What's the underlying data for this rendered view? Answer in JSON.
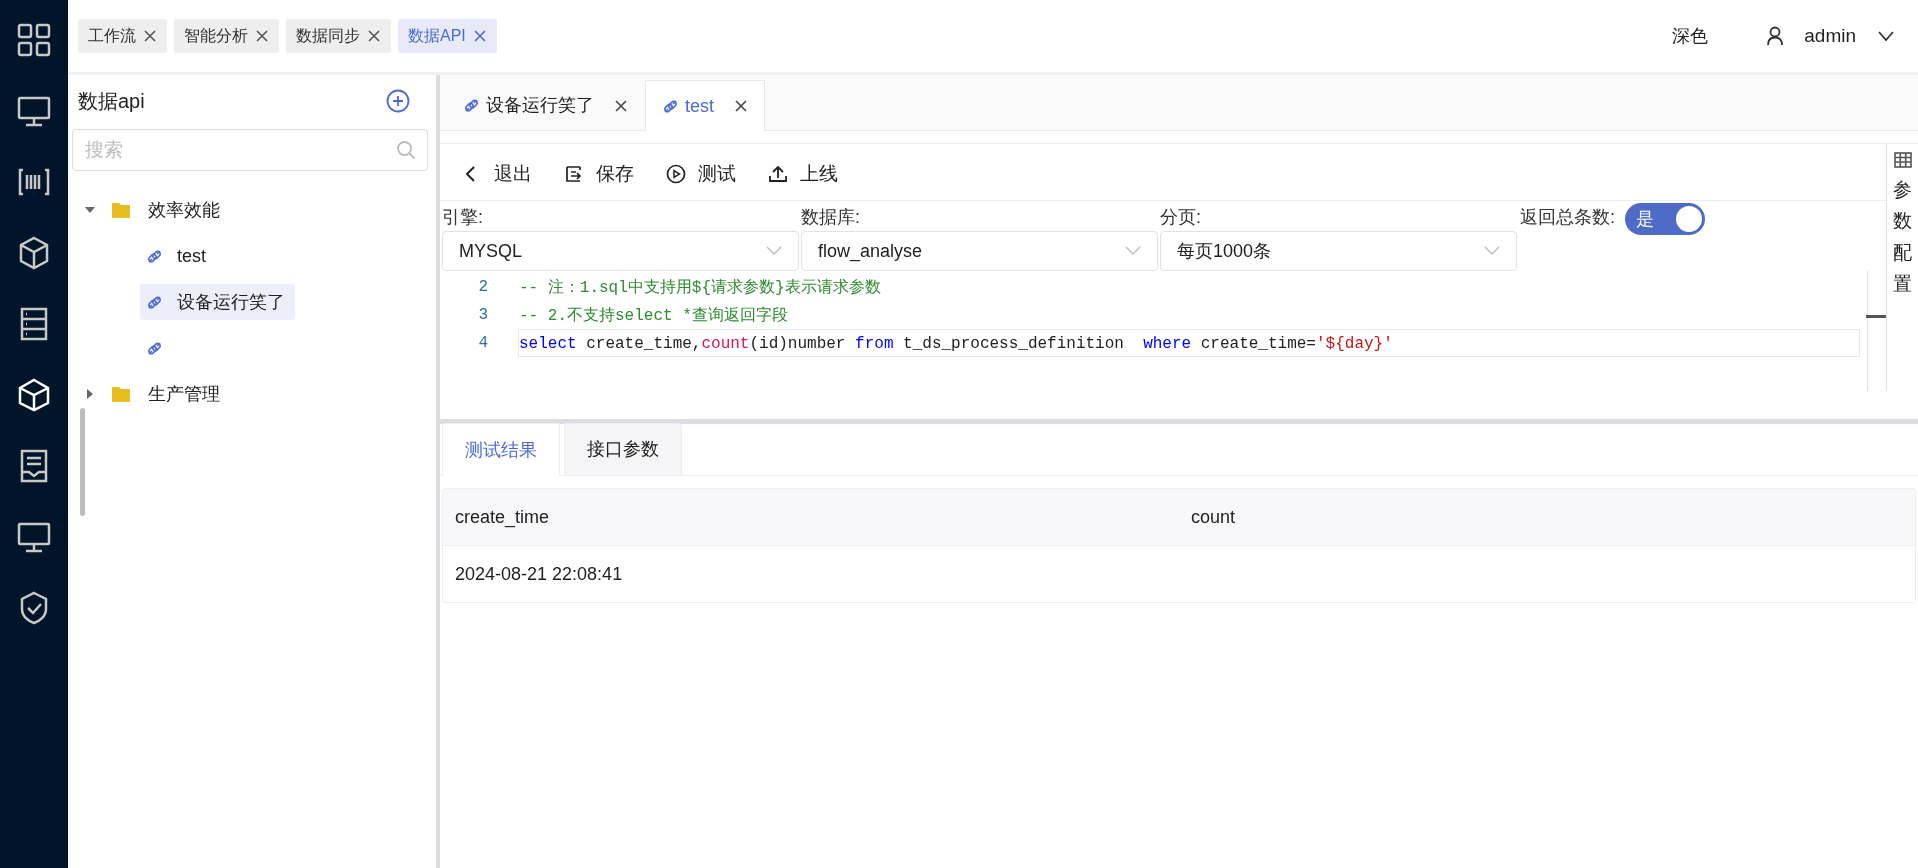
{
  "tags": [
    {
      "label": "工作流",
      "selected": false
    },
    {
      "label": "智能分析",
      "selected": false
    },
    {
      "label": "数据同步",
      "selected": false
    },
    {
      "label": "数据API",
      "selected": true
    }
  ],
  "header": {
    "theme": "深色",
    "user": "admin"
  },
  "sidebar": {
    "title": "数据api",
    "search": {
      "placeholder": "搜索"
    },
    "tree": [
      {
        "kind": "folder",
        "label": "效率效能",
        "expanded": true,
        "selected": false,
        "children": [
          {
            "kind": "api",
            "label": "test",
            "selected": false
          },
          {
            "kind": "api",
            "label": "设备运行笑了",
            "selected": true
          },
          {
            "kind": "api",
            "selected": false
          }
        ]
      },
      {
        "kind": "folder",
        "label": "生产管理",
        "expanded": false,
        "selected": false
      }
    ]
  },
  "tabs": [
    {
      "label": "设备运行笑了",
      "selected": false
    },
    {
      "label": "test",
      "selected": true
    }
  ],
  "toolbar": [
    {
      "kind": "back",
      "label": "退出"
    },
    {
      "kind": "save",
      "label": "保存"
    },
    {
      "kind": "test",
      "label": "测试"
    },
    {
      "kind": "publish",
      "label": "上线"
    }
  ],
  "form": {
    "selects": [
      {
        "label": "引擎:",
        "value": "MYSQL"
      },
      {
        "label": "数据库:",
        "value": "flow_analyse"
      },
      {
        "label": "分页:",
        "value": "每页1000条"
      }
    ],
    "total_switch": {
      "label": "返回总条数:",
      "on": true,
      "text": "是"
    }
  },
  "side_panel": {
    "label": "参数配置"
  },
  "editor": {
    "lines": [
      {
        "number": "2",
        "tokens": [
          {
            "kind": "comment",
            "text": "-- 注：1.sql中支持用${请求参数}表示请求参数"
          }
        ],
        "current": false
      },
      {
        "number": "3",
        "tokens": [
          {
            "kind": "comment",
            "text": "-- 2.不支持select *查询返回字段"
          }
        ],
        "current": false
      },
      {
        "number": "4",
        "current": true,
        "tokens": [
          {
            "kind": "keyword",
            "text": "select"
          },
          {
            "kind": "plain",
            "text": " create_time,"
          },
          {
            "kind": "function",
            "text": "count"
          },
          {
            "kind": "plain",
            "text": "(id)number "
          },
          {
            "kind": "keyword",
            "text": "from"
          },
          {
            "kind": "plain",
            "text": " t_ds_process_definition  "
          },
          {
            "kind": "keyword",
            "text": "where"
          },
          {
            "kind": "plain",
            "text": " create_time="
          },
          {
            "kind": "string",
            "text": "'${day}'"
          }
        ]
      }
    ]
  },
  "result_tabs": [
    {
      "label": "测试结果",
      "selected": true
    },
    {
      "label": "接口参数",
      "selected": false
    }
  ],
  "table": {
    "columns": [
      "create_time",
      "count"
    ],
    "rows": [
      [
        "2024-08-21 22:08:41",
        ""
      ]
    ]
  }
}
